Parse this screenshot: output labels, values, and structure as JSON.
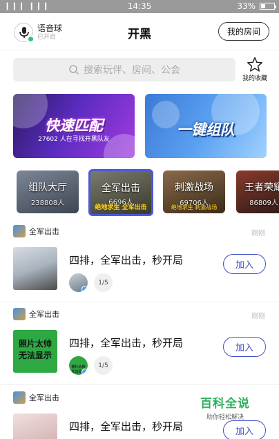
{
  "status_bar": {
    "signal": "❙❙❙ ❙❙❙",
    "time": "14:35",
    "battery": "33%"
  },
  "header": {
    "voice_title": "语音球",
    "voice_sub": "已开启",
    "title": "开黑",
    "my_room": "我的房间"
  },
  "search": {
    "placeholder": "搜索玩伴、房间、公会"
  },
  "favorites": {
    "label": "我的收藏"
  },
  "banners": [
    {
      "title": "快速匹配",
      "subtitle": "27602 人在寻找开黑队友"
    },
    {
      "title": "一键组队",
      "subtitle": ""
    }
  ],
  "modes": [
    {
      "name": "组队大厅",
      "count": "238808人"
    },
    {
      "name": "全军出击",
      "count": "6696人",
      "tag": "绝地求生 全军出击"
    },
    {
      "name": "刺激战场",
      "count": "69706人",
      "tag": "绝地求生 刺激战场"
    },
    {
      "name": "王者荣耀",
      "count": "86809人"
    }
  ],
  "feed": [
    {
      "game": "全军出击",
      "time": "刚刚",
      "title": "四排，全军出击，秒开局",
      "members": "1/5",
      "join": "加入"
    },
    {
      "game": "全军出击",
      "time": "刚刚",
      "title": "四排，全军出击，秒开局",
      "members": "1/5",
      "join": "加入",
      "thumb_text": "照片太帅\n无法显示",
      "avatar_text": "照片太帅\n无法显示"
    },
    {
      "game": "全军出击",
      "time": "",
      "title": "四排，全军出击，秒开局",
      "members": "",
      "join": "加入"
    }
  ],
  "watermark": {
    "title": "百科全说",
    "subtitle": "助你轻松解决"
  },
  "colors": {
    "accent": "#3f51c7",
    "status_bar": "#9a9a9a",
    "search_bg": "#eeeeee",
    "watermark": "#2bb25c"
  }
}
